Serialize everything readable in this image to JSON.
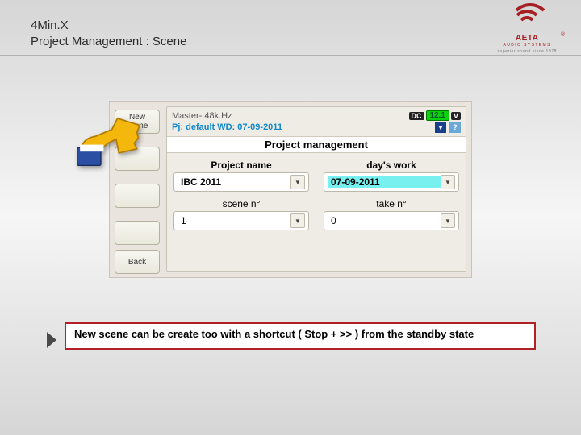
{
  "header": {
    "title_line1": "4Min.X",
    "title_line2": " Project Management : Scene"
  },
  "logo": {
    "brand": "AETA",
    "sub": "AUDIO SYSTEMS",
    "tag": "superior sound since 1978",
    "reg": "®"
  },
  "side_buttons": {
    "new_scene": "New\nscene",
    "back": "Back"
  },
  "panel": {
    "master": "Master- 48k.Hz",
    "dc_label": "DC",
    "dc_value": "12.1",
    "dc_unit": "V",
    "pj_line": "Pj: default  WD: 07-09-2011",
    "pm_title": "Project management",
    "labels": {
      "project_name": "Project name",
      "days_work": "day's work",
      "scene_no": "scene n°",
      "take_no": "take n°"
    },
    "values": {
      "project_name": "IBC 2011",
      "days_work": "07-09-2011",
      "scene_no": "1",
      "take_no": "0"
    }
  },
  "note": {
    "text": "New scene can be create  too with a shortcut ( Stop + >> ) from the standby state"
  }
}
